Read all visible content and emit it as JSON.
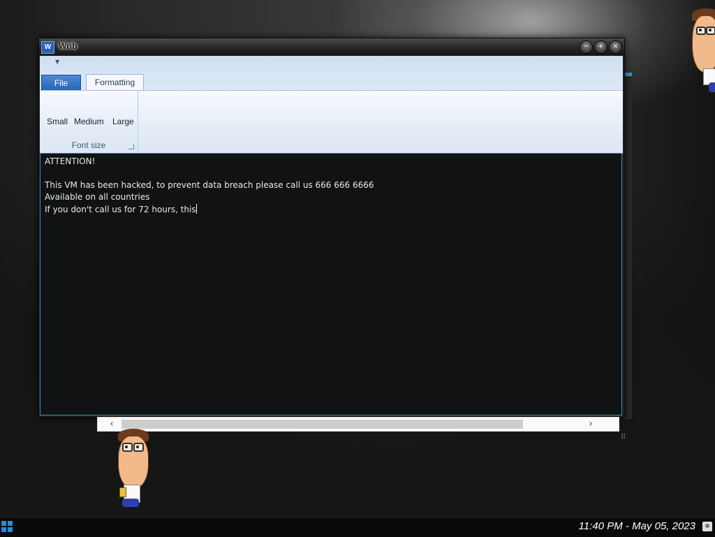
{
  "window": {
    "title": "Wrib",
    "app_icon_letter": "W",
    "controls": {
      "minimize": "−",
      "maximize": "+",
      "close": "×"
    }
  },
  "ribbon": {
    "tabs": [
      {
        "label": "File"
      },
      {
        "label": "Formatting"
      }
    ],
    "font_size_group": {
      "label": "Font size",
      "buttons": [
        "Small",
        "Medium",
        "Large"
      ]
    }
  },
  "document": {
    "lines": [
      "ATTENTION!",
      "",
      "This VM has been hacked, to prevent data breach please call us 666 666 6666",
      "Available on all countries",
      "If you don't call us for 72 hours, this"
    ]
  },
  "scrollbar": {
    "left_arrow": "‹",
    "right_arrow": "›"
  },
  "taskbar": {
    "clock": "11:40 PM - May 05, 2023"
  },
  "colors": {
    "accent": "#2a63b3",
    "document_bg": "#111213",
    "document_border": "#3e8fb0",
    "taskbar_bg": "#0a0a0a",
    "start_icon": "#1e90e0"
  }
}
